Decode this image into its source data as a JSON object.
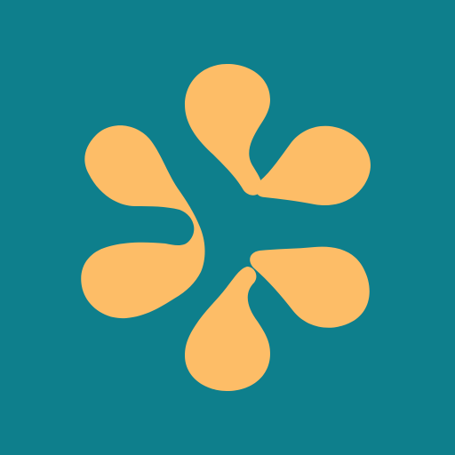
{
  "icon": {
    "name": "asterisk-flower-logo-icon",
    "background_color": "#0e7f8c",
    "petal_color": "#fdbd67"
  }
}
